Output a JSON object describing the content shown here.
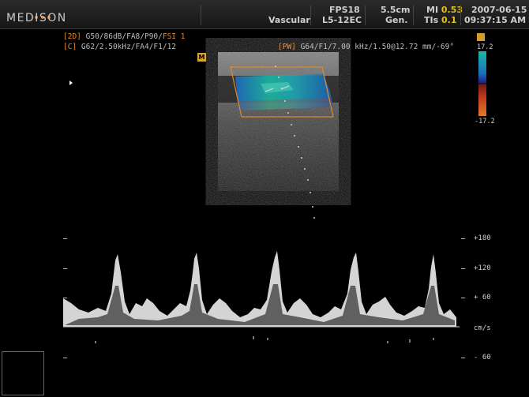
{
  "header": {
    "brand": "MEDISON",
    "application": "Vascular",
    "frame_rate": "FPS18",
    "probe": "L5-12EC",
    "depth": "5.5cm",
    "preset": "Gen.",
    "mi_label": "MI",
    "mi_value": "0.53",
    "tis_label": "TIs",
    "tis_value": "0.1",
    "date": "2007-06-15",
    "time": "09:37:15 AM"
  },
  "params": {
    "mode_2d_tag": "[2D]",
    "mode_2d_text": "G50/86dB/FA8/P90/",
    "mode_2d_fsi": "FSI 1",
    "mode_c_tag": "[C]",
    "mode_c_text": "G62/2.50kHz/FA4/F1/12",
    "mode_pw_tag": "[PW]",
    "mode_pw_text": "G64/F1/7.00 kHz/1.50@12.72 mm/-69°"
  },
  "m_badge": "M",
  "color_scale": {
    "top": "17.2",
    "bottom": "-17.2"
  },
  "doppler_axis": {
    "labels": [
      "+180",
      "+120",
      "+ 60",
      "cm/s",
      "- 60"
    ]
  },
  "colors": {
    "accent_orange": "#e08a2a",
    "yellow": "#e2c21a",
    "flow_cyan": "#1ab9a3",
    "flow_blue": "#1c6cc0"
  }
}
